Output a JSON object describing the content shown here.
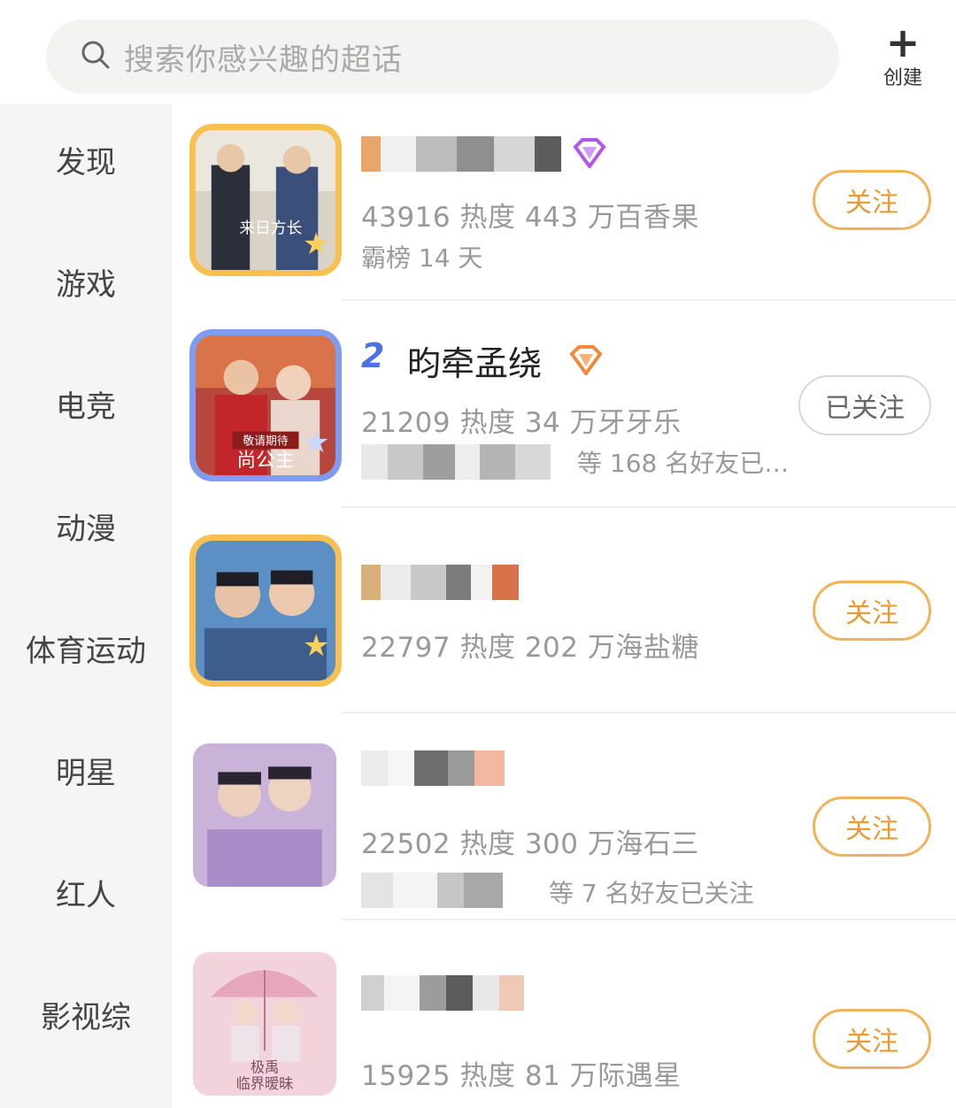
{
  "search": {
    "placeholder": "搜索你感兴趣的超话"
  },
  "create": {
    "label": "创建"
  },
  "categories": [
    "发现",
    "游戏",
    "电竞",
    "动漫",
    "体育运动",
    "明星",
    "红人",
    "影视综"
  ],
  "topics": [
    {
      "name": "",
      "stats": "43916 热度  443 万百香果",
      "meta": "霸榜 14 天",
      "friends": "",
      "button": "关注",
      "followed": false
    },
    {
      "rank": "2",
      "name": "昀牵孟绕",
      "stats": "21209 热度  34 万牙牙乐",
      "meta": "",
      "friends": "等 168 名好友已…",
      "button": "已关注",
      "followed": true
    },
    {
      "name": "",
      "stats": "22797 热度  202 万海盐糖",
      "meta": "",
      "friends": "",
      "button": "关注",
      "followed": false
    },
    {
      "name": "",
      "stats": "22502 热度  300 万海石三",
      "meta": "",
      "friends": "等 7 名好友已关注",
      "button": "关注",
      "followed": false
    },
    {
      "name": "",
      "stats": "15925 热度  81 万际遇星",
      "meta": "",
      "friends": "",
      "button": "关注",
      "followed": false
    }
  ],
  "avatar_texts": [
    "来日方长",
    "敬请期待",
    "尚公主",
    "极禹",
    "临界暧昧"
  ],
  "colors": {
    "accent": "#f2b25a",
    "accent_text": "#e89b32",
    "rank_blue": "#4a73e8",
    "gold_border": "#f7c050",
    "blue_border": "#7e9df0"
  },
  "icons": [
    "search-icon",
    "plus-icon",
    "gem-badge-icon",
    "star-icon"
  ]
}
